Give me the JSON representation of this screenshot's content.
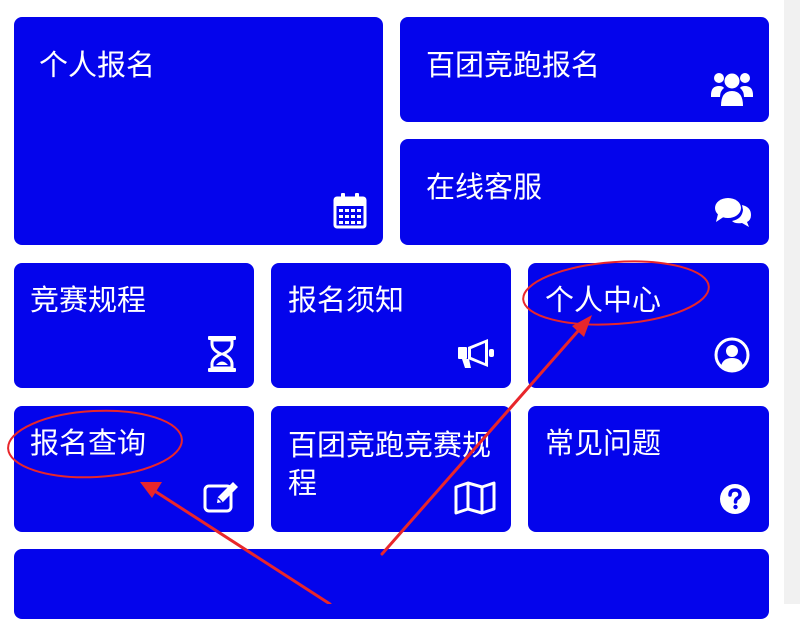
{
  "colors": {
    "tile_bg": "#0404ec",
    "tile_text": "#ffffff",
    "annotation": "#e8262b"
  },
  "tiles": [
    {
      "id": "personal-signup",
      "label": "个人报名",
      "icon": "calendar-icon"
    },
    {
      "id": "group-race-signup",
      "label": "百团竞跑报名",
      "icon": "users-icon"
    },
    {
      "id": "online-support",
      "label": "在线客服",
      "icon": "chat-icon"
    },
    {
      "id": "race-rules",
      "label": "竞赛规程",
      "icon": "hourglass-icon"
    },
    {
      "id": "signup-notice",
      "label": "报名须知",
      "icon": "megaphone-icon"
    },
    {
      "id": "personal-center",
      "label": "个人中心",
      "icon": "user-circle-icon"
    },
    {
      "id": "signup-query",
      "label": "报名查询",
      "icon": "edit-icon"
    },
    {
      "id": "group-race-rules",
      "label": "百团竞跑竞赛规\n程",
      "icon": "map-icon"
    },
    {
      "id": "faq",
      "label": "常见问题",
      "icon": "question-circle-icon"
    }
  ]
}
